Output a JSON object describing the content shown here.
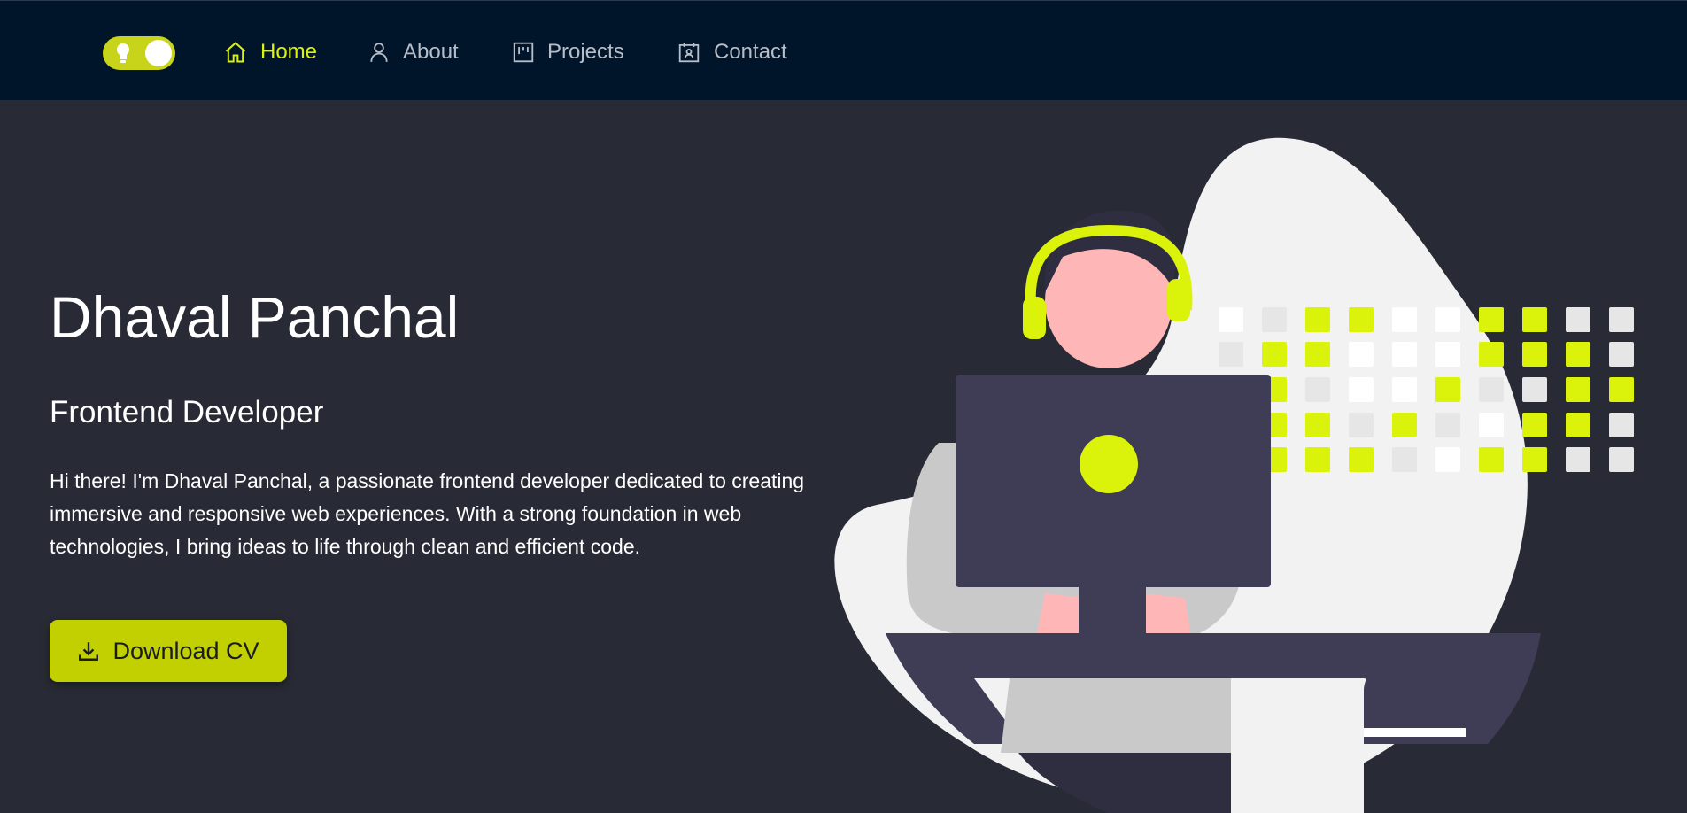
{
  "nav": {
    "items": [
      {
        "label": "Home",
        "icon": "home-icon",
        "active": true
      },
      {
        "label": "About",
        "icon": "user-icon",
        "active": false
      },
      {
        "label": "Projects",
        "icon": "kanban-icon",
        "active": false
      },
      {
        "label": "Contact",
        "icon": "contact-card-icon",
        "active": false
      }
    ],
    "theme_toggle_icon": "lightbulb-icon"
  },
  "hero": {
    "name": "Dhaval Panchal",
    "role": "Frontend Developer",
    "bio": "Hi there! I'm Dhaval Panchal, a passionate frontend developer dedicated to creating immersive and responsive web experiences. With a strong foundation in web technologies, I bring ideas to life through clean and efficient code.",
    "cta_label": "Download CV",
    "cta_icon": "download-icon"
  },
  "colors": {
    "accent": "#dbf20a",
    "button": "#c2d001",
    "background": "#282b35",
    "navbar": "#00142a",
    "nav_text": "#b8bec8"
  }
}
